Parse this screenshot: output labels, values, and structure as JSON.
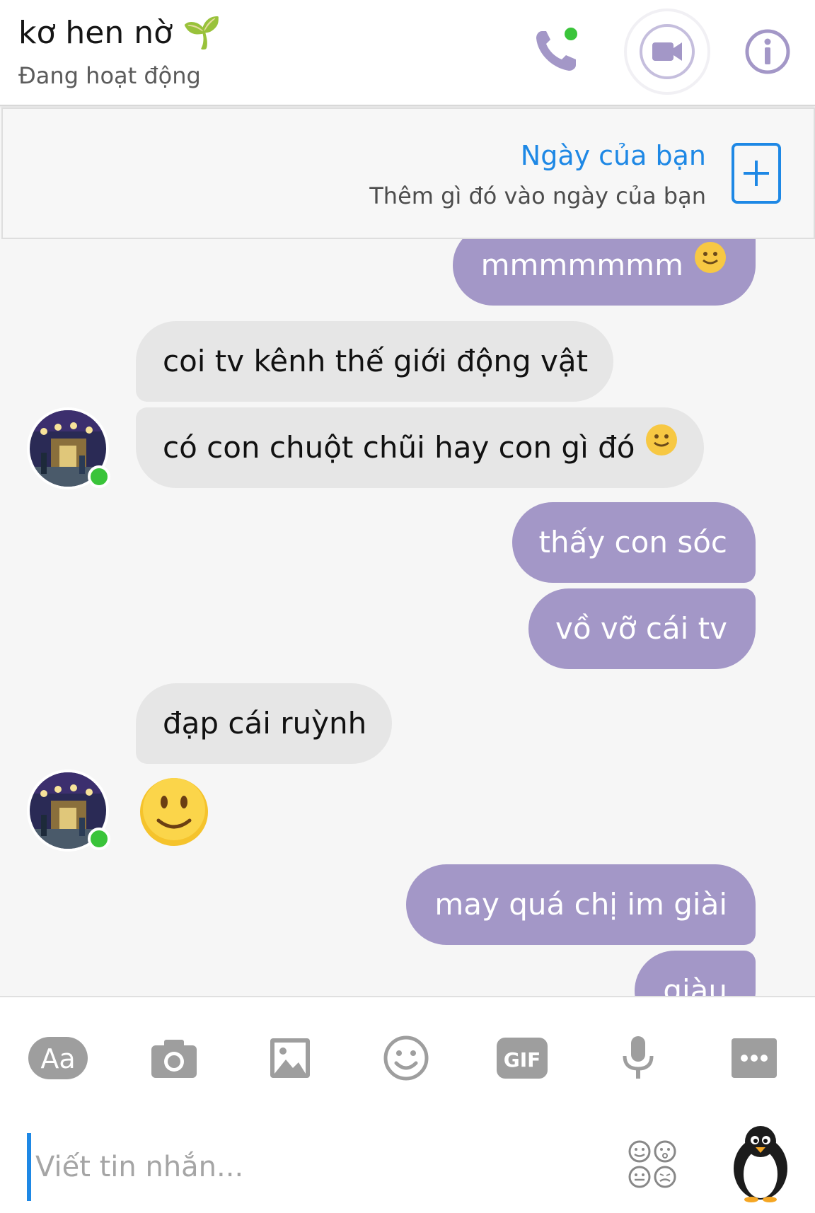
{
  "header": {
    "name": "kơ hen nờ",
    "name_emoji": "🌱",
    "status": "Đang hoạt động"
  },
  "your_day": {
    "title": "Ngày của bạn",
    "subtitle": "Thêm gì đó vào ngày của bạn"
  },
  "messages": [
    {
      "side": "sent",
      "text": "mmmmmmm",
      "emoji": "smiley-face"
    },
    {
      "side": "received",
      "text": "coi tv kênh thế giới động vật"
    },
    {
      "side": "received",
      "text": "có con chuột chũi hay con gì đó",
      "emoji": "smiley-face"
    },
    {
      "side": "sent",
      "text": "thấy con sóc"
    },
    {
      "side": "sent",
      "text": "vồ vỡ cái tv"
    },
    {
      "side": "received",
      "text": "đạp cái ruỳnh"
    },
    {
      "side": "received",
      "text": "",
      "emoji": "big-smiley-face"
    },
    {
      "side": "sent",
      "text": "may quá chị im giài"
    },
    {
      "side": "sent",
      "text": "giàu"
    }
  ],
  "composer": {
    "placeholder": "Viết tin nhắn...",
    "tools": [
      "text-format-icon",
      "camera-icon",
      "image-icon",
      "emoji-icon",
      "gif-icon",
      "microphone-icon",
      "more-icon"
    ],
    "text_tool_label": "Aa",
    "gif_label": "GIF"
  },
  "colors": {
    "accent": "#a397c7",
    "link": "#1e88e5",
    "received_bubble": "#e6e6e6",
    "online": "#3ac43a"
  }
}
